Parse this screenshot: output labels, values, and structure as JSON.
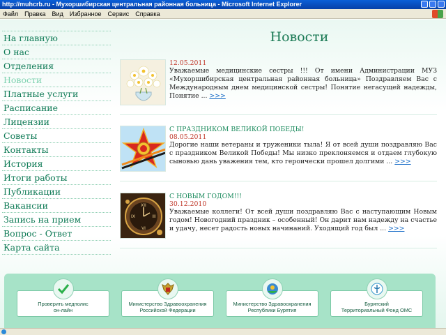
{
  "window": {
    "title": "http://muhcrb.ru - Мухоршибирская центральная районная больница - Microsoft Internet Explorer"
  },
  "menubar": [
    "Файл",
    "Правка",
    "Вид",
    "Избранное",
    "Сервис",
    "Справка"
  ],
  "sidebar": {
    "items": [
      {
        "label": "На главную"
      },
      {
        "label": "О нас"
      },
      {
        "label": "Отделения"
      },
      {
        "label": "Новости",
        "active": true
      },
      {
        "label": "Платные услуги"
      },
      {
        "label": "Расписание"
      },
      {
        "label": "Лицензии"
      },
      {
        "label": "Советы"
      },
      {
        "label": "Контакты"
      },
      {
        "label": "История"
      },
      {
        "label": "Итоги работы"
      },
      {
        "label": "Публикации"
      },
      {
        "label": "Вакансии"
      },
      {
        "label": "Запись на прием"
      },
      {
        "label": "Вопрос - Ответ"
      },
      {
        "label": "Карта сайта"
      }
    ]
  },
  "main": {
    "title": "Новости",
    "news": [
      {
        "headline": "",
        "date": "12.05.2011",
        "text": "Уважаемые медицинские сестры !!! От имени Администрации МУЗ «Мухоршибирская центральная районная больница» Поздравляем Вас с Международным днем медицинской сестры! Понятие негасущей надежды, Понятие ...",
        "more": ">>>",
        "image": "flowers-image"
      },
      {
        "headline": "С ПРАЗДНИКОМ ВЕЛИКОЙ ПОБЕДЫ!",
        "date": "08.05.2011",
        "text": "Дорогие наши ветераны и труженики тыла! Я от всей души поздравляю Вас с праздником Великой Победы! Мы низко преклоняемся и отдаем глубокую сыновью дань уважения тем, кто героически прошел долгими ...",
        "more": ">>>",
        "image": "victory-star-image"
      },
      {
        "headline": "С НОВЫМ ГОДОМ!!!",
        "date": "30.12.2010",
        "text": "Уважаемые коллеги! От всей души поздравляю Вас с наступающим Новым годом! Новогодний праздник – особенный! Он дарит нам надежду на счастье и удачу, несет радость новых начинаний. Уходящий год был ...",
        "more": ">>>",
        "image": "clock-image"
      }
    ]
  },
  "footer": {
    "links": [
      {
        "line1": "Проверить медполис",
        "line2": "он-лайн",
        "icon": "checkmark-icon"
      },
      {
        "line1": "Министерство Здравоохранения",
        "line2": "Российской Федерации",
        "icon": "russian-eagle-icon"
      },
      {
        "line1": "Министерство Здравоохранения",
        "line2": "Республики Бурятия",
        "icon": "buryatia-emblem-icon"
      },
      {
        "line1": "Бурятский",
        "line2": "Территориальный Фонд ОМС",
        "icon": "oms-emblem-icon"
      }
    ]
  },
  "colors": {
    "accent": "#1b7a55",
    "date": "#c0392b",
    "link": "#1a6ec8",
    "footer_band": "#a7e3c8"
  }
}
